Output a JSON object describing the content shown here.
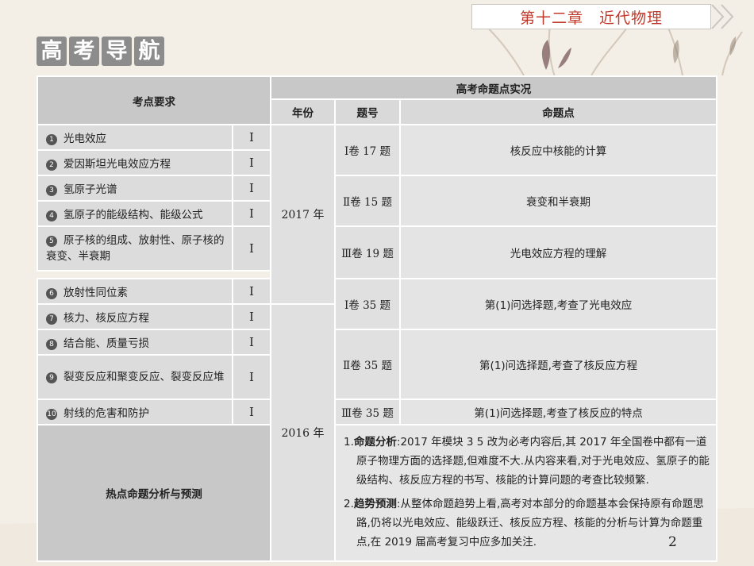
{
  "header": {
    "chapter": "第十二章　近代物理"
  },
  "title_chars": [
    "高",
    "考",
    "导",
    "航"
  ],
  "table": {
    "col_requirements": "考点要求",
    "col_actual": "高考命题点实况",
    "col_year": "年份",
    "col_qno": "题号",
    "col_point": "命题点",
    "requirements": [
      {
        "num": "1",
        "text": "光电效应",
        "level": "Ⅰ"
      },
      {
        "num": "2",
        "text": "爱因斯坦光电效应方程",
        "level": "Ⅰ"
      },
      {
        "num": "3",
        "text": "氢原子光谱",
        "level": "Ⅰ"
      },
      {
        "num": "4",
        "text": "氢原子的能级结构、能级公式",
        "level": "Ⅰ"
      },
      {
        "num": "5",
        "text": "原子核的组成、放射性、原子核的衰变、半衰期",
        "level": "Ⅰ"
      },
      {
        "num": "6",
        "text": "放射性同位素",
        "level": "Ⅰ"
      },
      {
        "num": "7",
        "text": "核力、核反应方程",
        "level": "Ⅰ"
      },
      {
        "num": "8",
        "text": "结合能、质量亏损",
        "level": "Ⅰ"
      },
      {
        "num": "9",
        "text": "裂变反应和聚变反应、裂变反应堆",
        "level": "Ⅰ"
      },
      {
        "num": "10",
        "text": "射线的危害和防护",
        "level": "Ⅰ"
      }
    ],
    "years": [
      "2017 年",
      "2016 年"
    ],
    "questions": [
      {
        "qno": "Ⅰ卷 17 题",
        "point": "核反应中核能的计算"
      },
      {
        "qno": "Ⅱ卷 15 题",
        "point": "衰变和半衰期"
      },
      {
        "qno": "Ⅲ卷 19 题",
        "point": "光电效应方程的理解"
      },
      {
        "qno": "Ⅰ卷 35 题",
        "point": "第(1)问选择题,考查了光电效应"
      },
      {
        "qno": "Ⅱ卷 35 题",
        "point": "第(1)问选择题,考查了核反应方程"
      },
      {
        "qno": "Ⅲ卷 35 题",
        "point": "第(1)问选择题,考查了核反应的特点"
      }
    ],
    "hot_label": "热点命题分析与预测",
    "analysis": [
      {
        "prefix": "1.",
        "head": "命题分析",
        "text": ":2017 年模块 3 5 改为必考内容后,其 2017 年全国卷中都有一道原子物理方面的选择题,但难度不大.从内容来看,对于光电效应、氢原子的能级结构、核反应方程的书写、核能的计算问题的考查比较频繁."
      },
      {
        "prefix": "2.",
        "head": "趋势预测",
        "text": ":从整体命题趋势上看,高考对本部分的命题基本会保持原有命题思路,仍将以光电效应、能级跃迁、核反应方程、核能的分析与计算为命题重点,在 2019 届高考复习中应多加关注."
      }
    ]
  },
  "page_number": "2"
}
